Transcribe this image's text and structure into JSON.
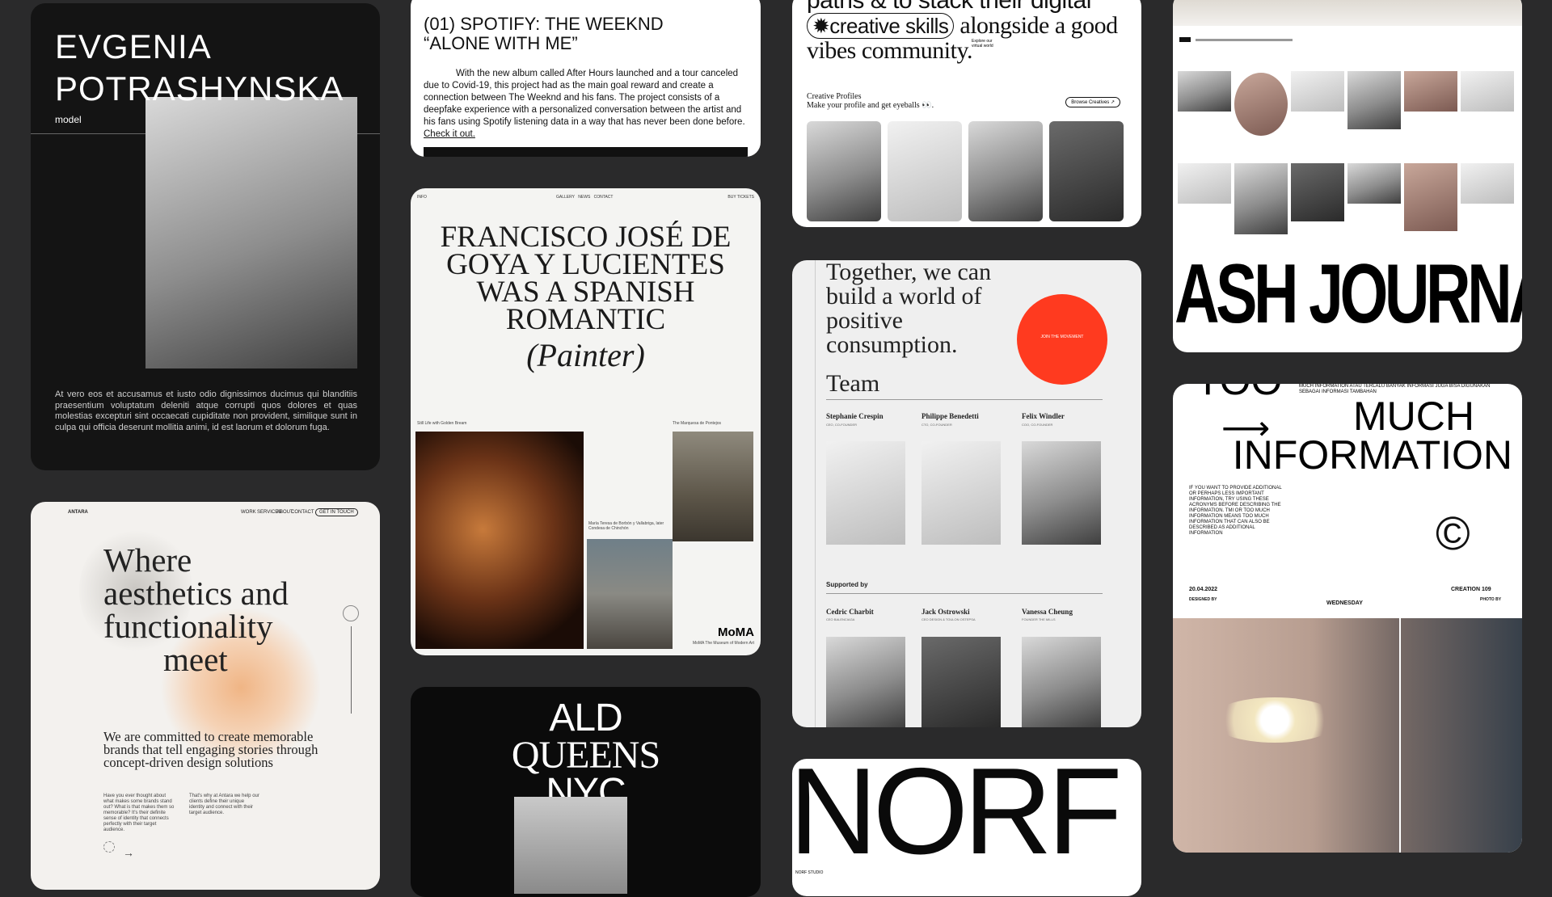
{
  "model_card": {
    "name_line1": "EVGENIA",
    "name_line2": "POTRASHYNSKA",
    "role": "model",
    "paragraph": "At vero eos et accusamus et iusto odio dignissimos ducimus qui blanditiis praesentium voluptatum deleniti atque corrupti quos dolores et quas molestias excepturi sint occaecati cupiditate non provident, similique sunt in culpa qui officia deserunt mollitia animi, id est laorum et dolorum fuga."
  },
  "spotify_card": {
    "title_line1": "(01) SPOTIFY: THE WEEKND",
    "title_line2": "“ALONE WITH ME”",
    "body": "With the new album called After Hours launched and a tour canceled due to Covid-19, this project had as the main goal reward and create a connection between The Weeknd and his fans. The project consists of a deepfake experience with a personalized conversation between the artist and his fans using Spotify listening data in a way that has never been done before.",
    "link": "Check it out."
  },
  "goya_card": {
    "nav_left": "INFO",
    "nav_center": "GALLERY   NEWS   CONTACT",
    "nav_right": "BUY TICKETS",
    "headline": "FRANCISCO JOSÉ DE GOYA Y LUCIENTES WAS A SPANISH ROMANTIC",
    "headline_italic": "(Painter)",
    "caption_1": "Still Life with Golden Bream",
    "caption_2": "The Marquesa de Pontejos",
    "caption_3": "María Teresa de Borbón y Vallabriga, later Condesa de Chinchón",
    "logo": "MoMA",
    "logo_sub": "MoMA The Museum of Modern Art"
  },
  "ald_card": {
    "line1": "ALD",
    "line2": "QUEENS",
    "line3": "NYC"
  },
  "antara_card": {
    "brand": "ANTARA",
    "nav": [
      "WORK",
      "SERVICES",
      "ABOUT",
      "CONTACT"
    ],
    "cta": "GET IN TOUCH",
    "hero_line1": "Where",
    "hero_line2": "aesthetics and",
    "hero_line3": "functionality",
    "hero_line4": "meet",
    "commitment": "We are committed to create memorable brands that tell engaging stories through concept-driven design solutions",
    "q1": "Have you ever thought about what makes some brands stand out? What is that makes them so memorable? It's their definite sense of identity that connects perfectly with their target audience.",
    "q2": "That's why at Antara we help our clients define their unique identity and connect with their target audience."
  },
  "community_card": {
    "line1": "paths & to stack their digital",
    "pill": "✹creative skills",
    "line2_rest": "alongside a good",
    "line3": "vibes community.",
    "explore": "Explore our virtual world",
    "section": "Creative Profiles",
    "subtitle": "Make your profile and get eyeballs 👀.",
    "browse": "Browse Creatives ↗"
  },
  "team_card": {
    "headline": "Together, we can build a world of positive consumption.",
    "join": "JOIN THE MOVEMENT",
    "team_title": "Team",
    "team": [
      {
        "name": "Stephanie Crespin",
        "role": "CEO, CO-FOUNDER"
      },
      {
        "name": "Philippe Benedetti",
        "role": "CTO, CO-FOUNDER"
      },
      {
        "name": "Felix Windler",
        "role": "COO, CO-FOUNDER"
      }
    ],
    "supported_by": "Supported by",
    "supporters": [
      {
        "name": "Cedric Charbit",
        "role": "CEO BALENCIAGA"
      },
      {
        "name": "Jack Ostrowski",
        "role": "CEO DESIGN & TOULON OSTEPSA"
      },
      {
        "name": "Vanessa Cheung",
        "role": "FOUNDER THE MILLS"
      }
    ]
  },
  "norf_card": {
    "wordmark": "NORF",
    "footer": "NORF STUDIO"
  },
  "ash_card": {
    "wordmark": "ASH JOURNAL"
  },
  "tmi_card": {
    "line1": "TOO",
    "line2": "MUCH",
    "line3": "INFORMATION",
    "subline": "MUCH INFORMATION ATAU TERLALU BANYAK INFORMASI JUGA BISA DIGUNAKAN SEBAGAI INFORMASI TAMBAHAN",
    "note": "IF YOU WANT TO PROVIDE ADDITIONAL OR PERHAPS LESS IMPORTANT INFORMATION, TRY USING THESE ACRONYMS BEFORE DESCRIBING THE INFORMATION. TMI OR TOO MUCH INFORMATION MEANS TOO MUCH INFORMATION THAT CAN ALSO BE DESCRIBED AS ADDITIONAL INFORMATION",
    "date": "20.04.2022",
    "day": "WEDNESDAY",
    "creation": "CREATION 109",
    "designed_by": "DESIGNED BY",
    "photo_by": "PHOTO BY"
  },
  "colors": {
    "background": "#2a2a2b",
    "accent_red": "#ff3a1f"
  }
}
